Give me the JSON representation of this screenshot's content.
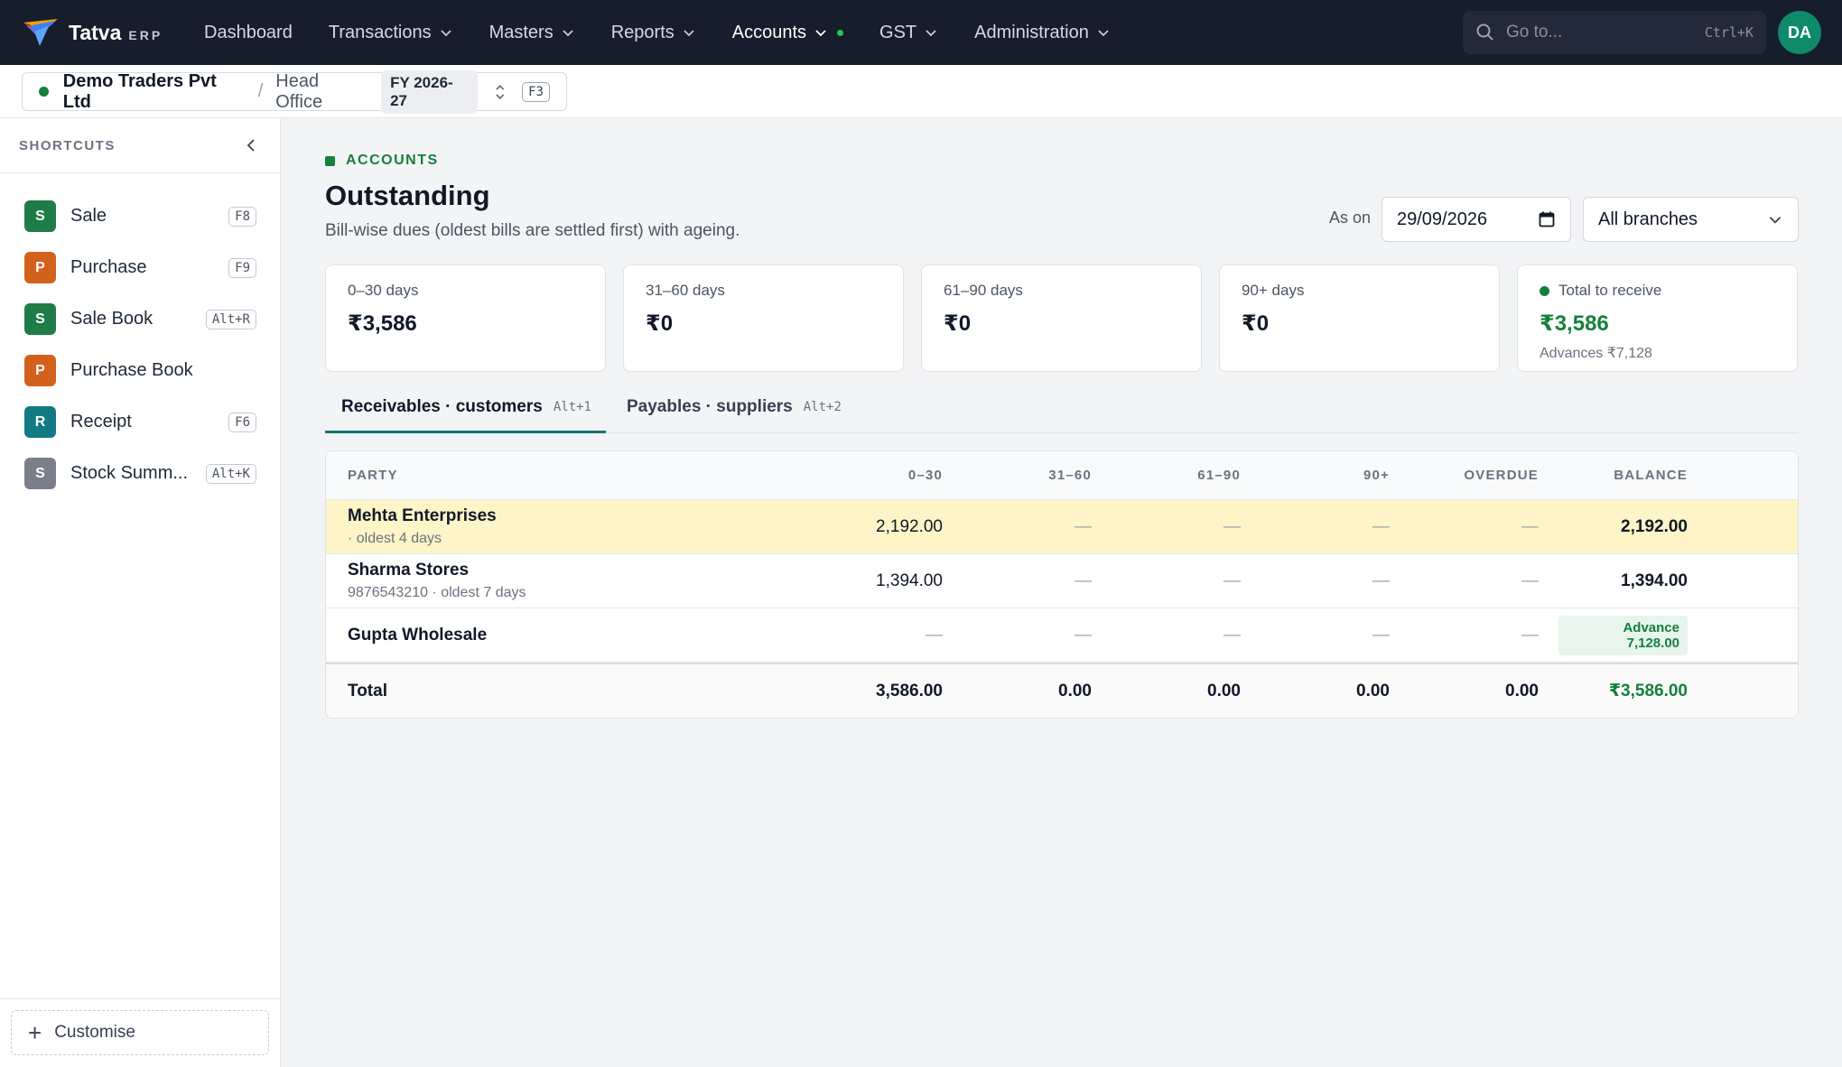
{
  "app": {
    "name": "Tatva",
    "suffix": "ERP"
  },
  "nav": [
    {
      "label": "Dashboard",
      "has_menu": false
    },
    {
      "label": "Transactions",
      "has_menu": true
    },
    {
      "label": "Masters",
      "has_menu": true
    },
    {
      "label": "Reports",
      "has_menu": true
    },
    {
      "label": "Accounts",
      "has_menu": true,
      "active": true
    },
    {
      "label": "GST",
      "has_menu": true
    },
    {
      "label": "Administration",
      "has_menu": true
    }
  ],
  "search": {
    "placeholder": "Go to...",
    "shortcut": "Ctrl+K"
  },
  "user": {
    "initials": "DA"
  },
  "context": {
    "company": "Demo Traders Pvt Ltd",
    "branch": "Head Office",
    "fy": "FY 2026-27",
    "shortcut": "F3"
  },
  "sidebar": {
    "title": "SHORTCUTS",
    "items": [
      {
        "letter": "S",
        "label": "Sale",
        "key": "F8",
        "color": "#1e7d47"
      },
      {
        "letter": "P",
        "label": "Purchase",
        "key": "F9",
        "color": "#d2611b"
      },
      {
        "letter": "S",
        "label": "Sale Book",
        "key": "Alt+R",
        "color": "#1e7d47"
      },
      {
        "letter": "P",
        "label": "Purchase Book",
        "key": "",
        "color": "#d2611b"
      },
      {
        "letter": "R",
        "label": "Receipt",
        "key": "F6",
        "color": "#127a83"
      },
      {
        "letter": "S",
        "label": "Stock Summ...",
        "key": "Alt+K",
        "color": "#7a7f8a"
      }
    ],
    "customise_label": "Customise"
  },
  "page": {
    "eyebrow": "ACCOUNTS",
    "title": "Outstanding",
    "subtitle": "Bill-wise dues (oldest bills are settled first) with ageing.",
    "as_on_label": "As on",
    "as_on_date": "29/09/2026",
    "branch_filter": "All branches"
  },
  "cards": [
    {
      "label": "0–30 days",
      "value": "₹3,586",
      "note": ""
    },
    {
      "label": "31–60 days",
      "value": "₹0",
      "note": ""
    },
    {
      "label": "61–90 days",
      "value": "₹0",
      "note": ""
    },
    {
      "label": "90+ days",
      "value": "₹0",
      "note": ""
    },
    {
      "label": "Total to receive",
      "value": "₹3,586",
      "note": "Advances ₹7,128"
    }
  ],
  "tabs": [
    {
      "label": "Receivables · customers",
      "key": "Alt+1",
      "active": true
    },
    {
      "label": "Payables · suppliers",
      "key": "Alt+2",
      "active": false
    }
  ],
  "table": {
    "columns": [
      "PARTY",
      "0–30",
      "31–60",
      "61–90",
      "90+",
      "OVERDUE",
      "BALANCE"
    ],
    "rows": [
      {
        "party": "Mehta Enterprises",
        "meta": "· oldest 4 days",
        "d0_30": "2,192.00",
        "d31_60": "—",
        "d61_90": "—",
        "d90": "—",
        "overdue": "—",
        "balance": "2,192.00",
        "highlight": true
      },
      {
        "party": "Sharma Stores",
        "meta": "9876543210 · oldest 7 days",
        "d0_30": "1,394.00",
        "d31_60": "—",
        "d61_90": "—",
        "d90": "—",
        "overdue": "—",
        "balance": "1,394.00",
        "highlight": false
      },
      {
        "party": "Gupta Wholesale",
        "meta": "",
        "d0_30": "—",
        "d31_60": "—",
        "d61_90": "—",
        "d90": "—",
        "overdue": "—",
        "balance": "Advance 7,128.00",
        "advance": true,
        "highlight": false
      }
    ],
    "total": {
      "label": "Total",
      "d0_30": "3,586.00",
      "d31_60": "0.00",
      "d61_90": "0.00",
      "d90": "0.00",
      "overdue": "0.00",
      "balance": "₹3,586.00"
    }
  }
}
